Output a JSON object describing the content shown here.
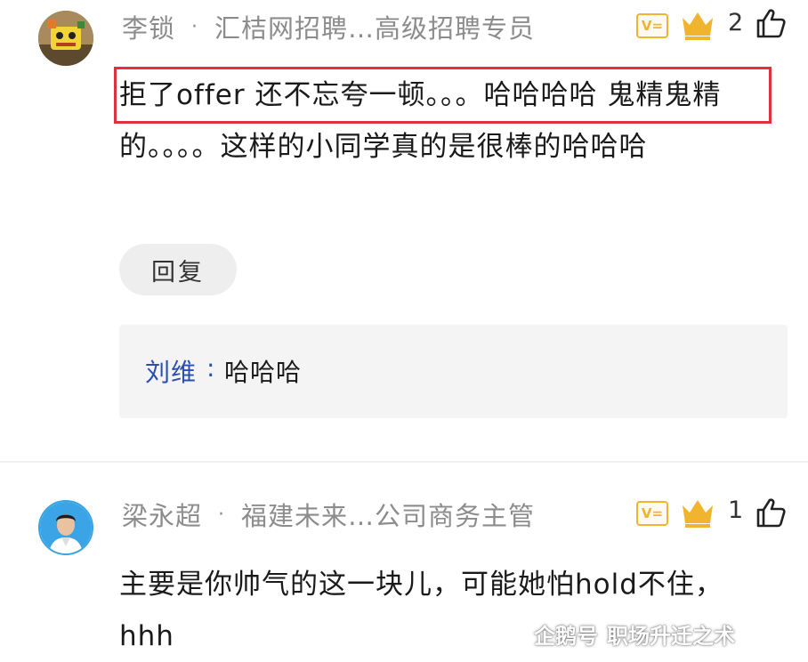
{
  "comments": [
    {
      "author": "李锁",
      "meta_separator": "·",
      "company_title": "汇桔网招聘…高级招聘专员",
      "badge_text": "V=",
      "likes": "2",
      "text": "拒了offer 还不忘夸一顿。。。哈哈哈哈  鬼精鬼精的。。。。这样的小同学真的是很棒的哈哈哈",
      "reply_button": "回复",
      "sub_reply": {
        "author": "刘维",
        "separator": ":",
        "text": "哈哈哈"
      }
    },
    {
      "author": "梁永超",
      "meta_separator": "·",
      "company_title": "福建未来…公司商务主管",
      "badge_text": "V=",
      "likes": "1",
      "text": "主要是你帅气的这一块儿，可能她怕hold不住，hhh"
    }
  ],
  "watermark": {
    "left": "企鹅号",
    "right": "职场升迁之术"
  },
  "colors": {
    "highlight_border": "#e0303a",
    "badge": "#f1b42f",
    "sub_reply_author": "#2a4fb3",
    "meta_text": "#8c8c8c"
  },
  "icons": {
    "like": "thumbs-up-icon",
    "vip": "crown-icon",
    "verified": "verified-badge-icon"
  }
}
